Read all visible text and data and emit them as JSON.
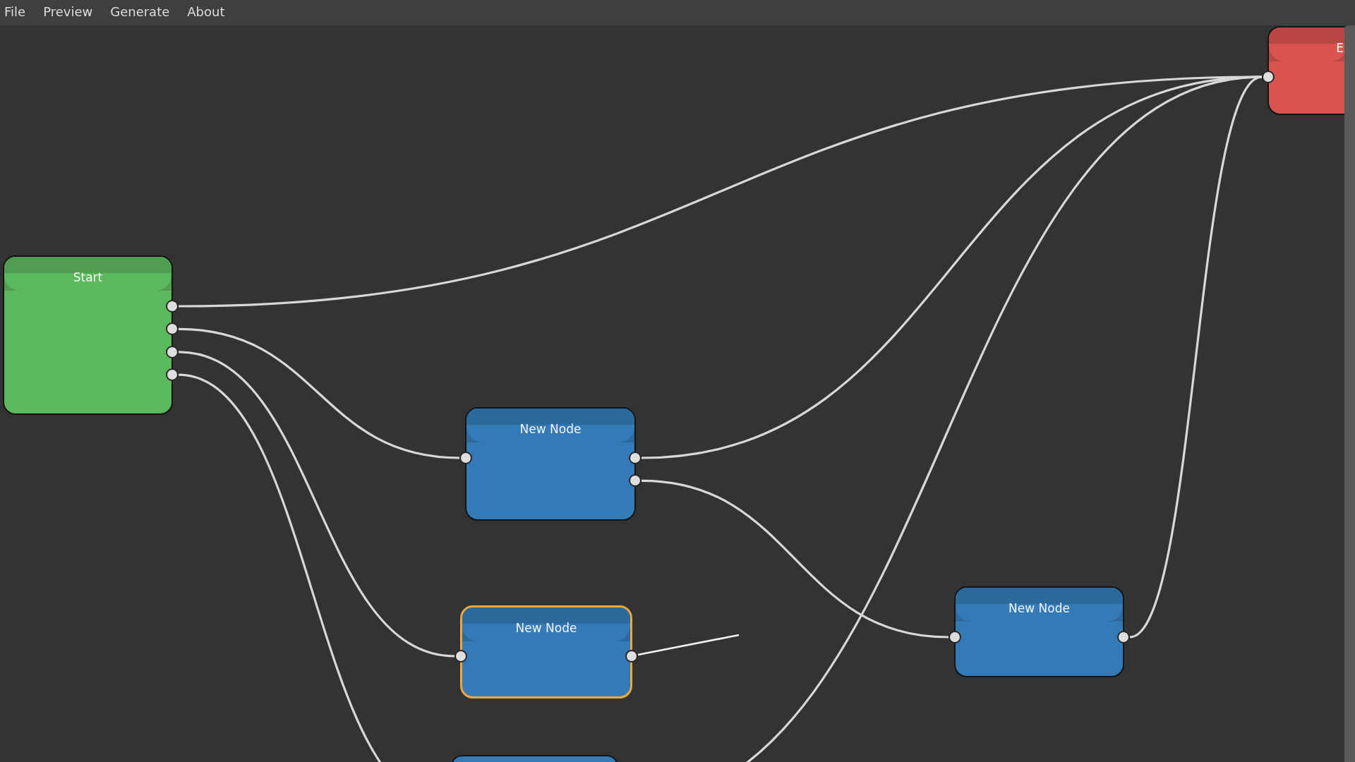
{
  "menu": [
    {
      "label": "File"
    },
    {
      "label": "Preview"
    },
    {
      "label": "Generate"
    },
    {
      "label": "About"
    }
  ],
  "canvas": {
    "nodes": [
      {
        "title": "Start",
        "color": "#5cb85c",
        "selected": false
      },
      {
        "title": "New Node",
        "color": "#337ab7",
        "selected": false
      },
      {
        "title": "New Node",
        "color": "#337ab7",
        "selected": true
      },
      {
        "title": "New Node",
        "color": "#337ab7",
        "selected": false
      },
      {
        "title": "E",
        "color": "#d9534f",
        "selected": false
      },
      {
        "color": "#337ab7",
        "selected": false
      }
    ]
  }
}
